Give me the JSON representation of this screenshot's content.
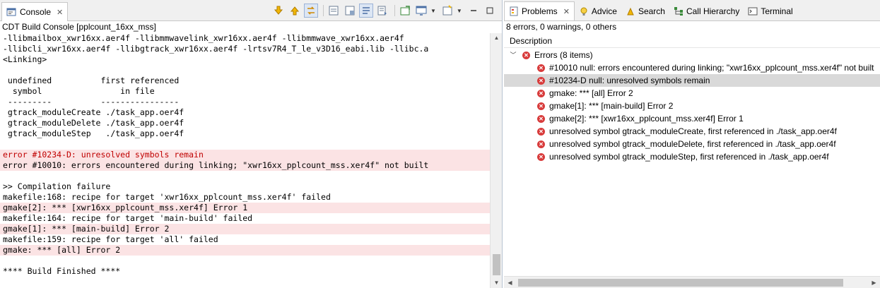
{
  "console_tab": {
    "label": "Console"
  },
  "console_title": "CDT Build Console [pplcount_16xx_mss]",
  "console_lines": [
    {
      "text": "-llibmailbox_xwr16xx.aer4f -llibmmwavelink_xwr16xx.aer4f -llibmmwave_xwr16xx.aer4f",
      "kind": "normal"
    },
    {
      "text": "-llibcli_xwr16xx.aer4f -llibgtrack_xwr16xx.aer4f -lrtsv7R4_T_le_v3D16_eabi.lib -llibc.a",
      "kind": "normal"
    },
    {
      "text": "<Linking>",
      "kind": "normal"
    },
    {
      "text": "",
      "kind": "normal"
    },
    {
      "text": " undefined          first referenced",
      "kind": "normal"
    },
    {
      "text": "  symbol                in file",
      "kind": "normal"
    },
    {
      "text": " ---------          ----------------",
      "kind": "normal"
    },
    {
      "text": " gtrack_moduleCreate ./task_app.oer4f",
      "kind": "normal"
    },
    {
      "text": " gtrack_moduleDelete ./task_app.oer4f",
      "kind": "normal"
    },
    {
      "text": " gtrack_moduleStep   ./task_app.oer4f",
      "kind": "normal"
    },
    {
      "text": "",
      "kind": "normal"
    },
    {
      "text": "error #10234-D: unresolved symbols remain",
      "kind": "err"
    },
    {
      "text": "error #10010: errors encountered during linking; \"xwr16xx_pplcount_mss.xer4f\" not built",
      "kind": "warn"
    },
    {
      "text": "",
      "kind": "normal"
    },
    {
      "text": ">> Compilation failure",
      "kind": "normal"
    },
    {
      "text": "makefile:168: recipe for target 'xwr16xx_pplcount_mss.xer4f' failed",
      "kind": "normal"
    },
    {
      "text": "gmake[2]: *** [xwr16xx_pplcount_mss.xer4f] Error 1",
      "kind": "warn"
    },
    {
      "text": "makefile:164: recipe for target 'main-build' failed",
      "kind": "normal"
    },
    {
      "text": "gmake[1]: *** [main-build] Error 2",
      "kind": "warn"
    },
    {
      "text": "makefile:159: recipe for target 'all' failed",
      "kind": "normal"
    },
    {
      "text": "gmake: *** [all] Error 2",
      "kind": "warn"
    },
    {
      "text": "",
      "kind": "normal"
    },
    {
      "text": "**** Build Finished ****",
      "kind": "normal"
    }
  ],
  "right_tabs": [
    {
      "label": "Problems",
      "icon": "problems-icon",
      "active": true
    },
    {
      "label": "Advice",
      "icon": "lightbulb-icon",
      "active": false
    },
    {
      "label": "Search",
      "icon": "search-icon",
      "active": false
    },
    {
      "label": "Call Hierarchy",
      "icon": "call-hierarchy-icon",
      "active": false
    },
    {
      "label": "Terminal",
      "icon": "terminal-icon",
      "active": false
    }
  ],
  "problems": {
    "summary": "8 errors, 0 warnings, 0 others",
    "column_header": "Description",
    "group_label": "Errors (8 items)",
    "items": [
      {
        "text": "#10010 null: errors encountered during linking; \"xwr16xx_pplcount_mss.xer4f\" not built",
        "selected": false
      },
      {
        "text": "#10234-D null: unresolved symbols remain",
        "selected": true
      },
      {
        "text": "gmake: *** [all] Error 2",
        "selected": false
      },
      {
        "text": "gmake[1]: *** [main-build] Error 2",
        "selected": false
      },
      {
        "text": "gmake[2]: *** [xwr16xx_pplcount_mss.xer4f] Error 1",
        "selected": false
      },
      {
        "text": "unresolved symbol gtrack_moduleCreate, first referenced in ./task_app.oer4f",
        "selected": false
      },
      {
        "text": "unresolved symbol gtrack_moduleDelete, first referenced in ./task_app.oer4f",
        "selected": false
      },
      {
        "text": "unresolved symbol gtrack_moduleStep, first referenced in ./task_app.oer4f",
        "selected": false
      }
    ]
  },
  "colors": {
    "error_bg": "#fbe3e4",
    "error_text": "#c00000",
    "error_icon": "#d83b3b",
    "selection": "#d9d9d9"
  }
}
